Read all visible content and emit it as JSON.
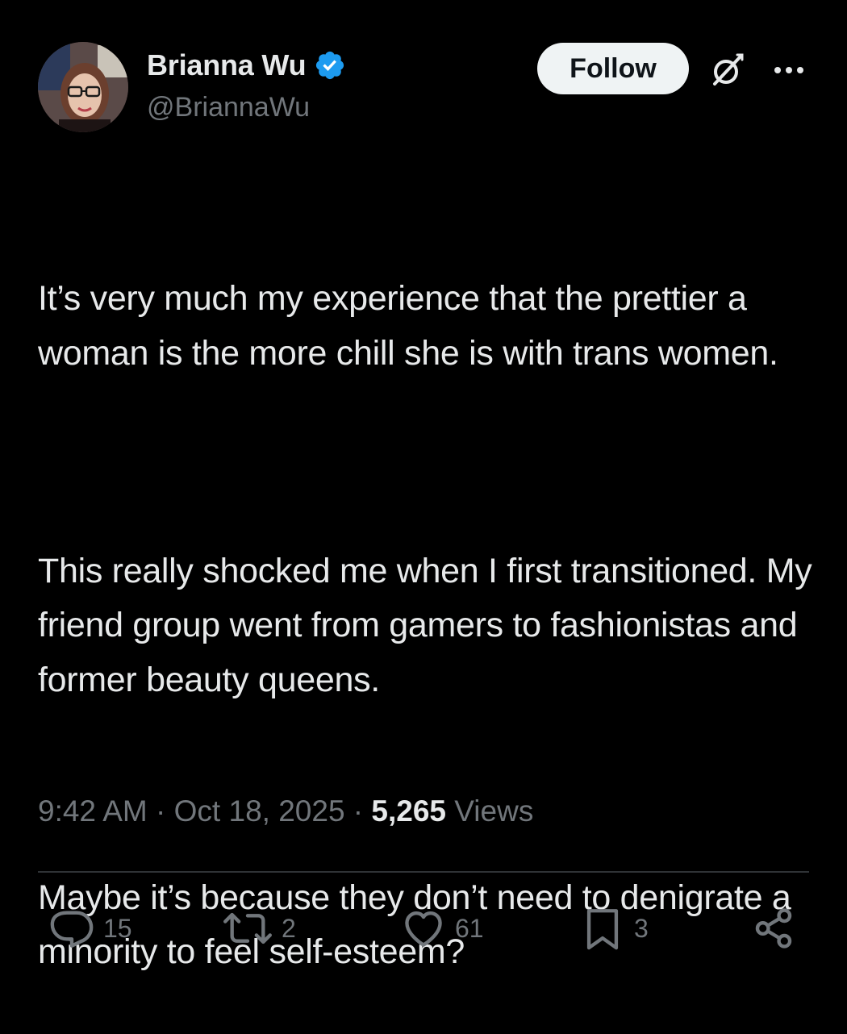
{
  "user": {
    "display_name": "Brianna Wu",
    "handle": "@BriannaWu",
    "verified": true,
    "verified_color": "#1d9bf0"
  },
  "header": {
    "follow_label": "Follow",
    "grok_icon": "grok-icon",
    "more_icon": "more-horizontal-icon"
  },
  "tweet": {
    "paragraphs": [
      "It’s very much my experience that the prettier a woman is the more chill she is with trans women.",
      "This really shocked me when I first transitioned. My friend group went from gamers to fashionistas and former beauty queens.",
      "Maybe it’s because they don’t need to denigrate a minority to feel self-esteem?"
    ]
  },
  "meta": {
    "time": "9:42 AM",
    "separator": " · ",
    "date": "Oct 18, 2025",
    "views_count": "5,265",
    "views_label": "Views"
  },
  "actions": {
    "replies": "15",
    "reposts": "2",
    "likes": "61",
    "bookmarks": "3"
  },
  "colors": {
    "background": "#000000",
    "text_primary": "#e7e9ea",
    "text_secondary": "#71767b",
    "divider": "#2f3336",
    "button_bg": "#eff3f4"
  }
}
